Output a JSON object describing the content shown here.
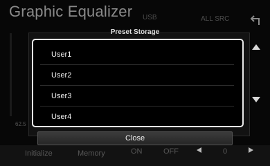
{
  "background": {
    "title": "Graphic Equalizer",
    "source": "USB",
    "all_src": "ALL SRC",
    "freq_label": "62.5",
    "initialize_label": "Initialize",
    "memory_label": "Memory",
    "on_label": "ON",
    "off_label": "OFF",
    "value": "0"
  },
  "popup": {
    "title": "Preset Storage",
    "items": [
      "User1",
      "User2",
      "User3",
      "User4"
    ],
    "close_label": "Close"
  }
}
